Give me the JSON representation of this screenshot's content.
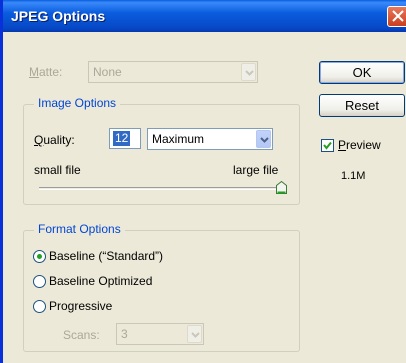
{
  "window": {
    "title": "JPEG Options"
  },
  "matte": {
    "label_prefix": "M",
    "label_rest": "atte:",
    "value": "None"
  },
  "image_options": {
    "legend": "Image Options",
    "quality_label_prefix": "Q",
    "quality_label_rest": "uality:",
    "quality_value": "12",
    "quality_preset": "Maximum",
    "small_label": "small file",
    "large_label": "large file",
    "quality_level": 1.0
  },
  "format_options": {
    "legend": "Format Options",
    "options": [
      "Baseline (“Standard”)",
      "Baseline Optimized",
      "Progressive"
    ],
    "selected_index": 0,
    "scans_label": "Scans:",
    "scans_value": "3"
  },
  "buttons": {
    "ok": "OK",
    "reset": "Reset"
  },
  "preview": {
    "label_prefix": "P",
    "label_rest": "review",
    "checked": true,
    "size": "1.1M"
  },
  "colors": {
    "title_bar": "#0a5dde",
    "dialog_bg": "#ece9d8",
    "group_legend": "#0046d5",
    "radio_dot": "#21a121"
  },
  "icons": [
    "close-icon",
    "dropdown-arrow-icon",
    "checkmark-icon",
    "slider-thumb-icon"
  ]
}
